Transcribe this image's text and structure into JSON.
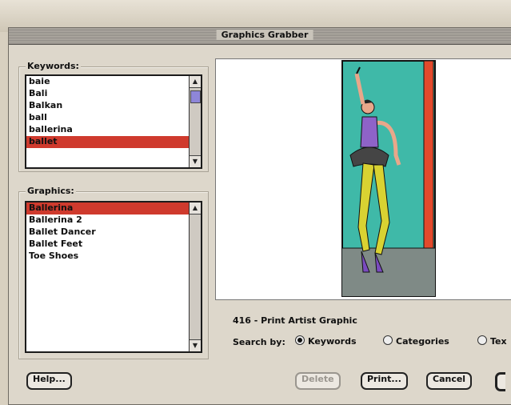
{
  "window": {
    "title": "Graphics Grabber"
  },
  "keywords": {
    "label": "Keywords:",
    "items": [
      "baie",
      "Bali",
      "Balkan",
      "ball",
      "ballerina",
      "ballet"
    ],
    "selected_index": 5
  },
  "graphics": {
    "label": "Graphics:",
    "items": [
      "Ballerina",
      "Ballerina 2",
      "Ballet Dancer",
      "Ballet Feet",
      "Toe Shoes"
    ],
    "selected_index": 0
  },
  "preview": {
    "caption": "416 - Print Artist Graphic"
  },
  "search": {
    "label": "Search by:",
    "options": [
      "Keywords",
      "Categories",
      "Tex"
    ],
    "selected": "Keywords"
  },
  "buttons": {
    "help": "Help...",
    "delete": "Delete",
    "print": "Print...",
    "cancel": "Cancel"
  },
  "colors": {
    "selection": "#cf3a2d",
    "preview_background": "#3fb9a8",
    "scroll_thumb": "#8e86d8"
  }
}
